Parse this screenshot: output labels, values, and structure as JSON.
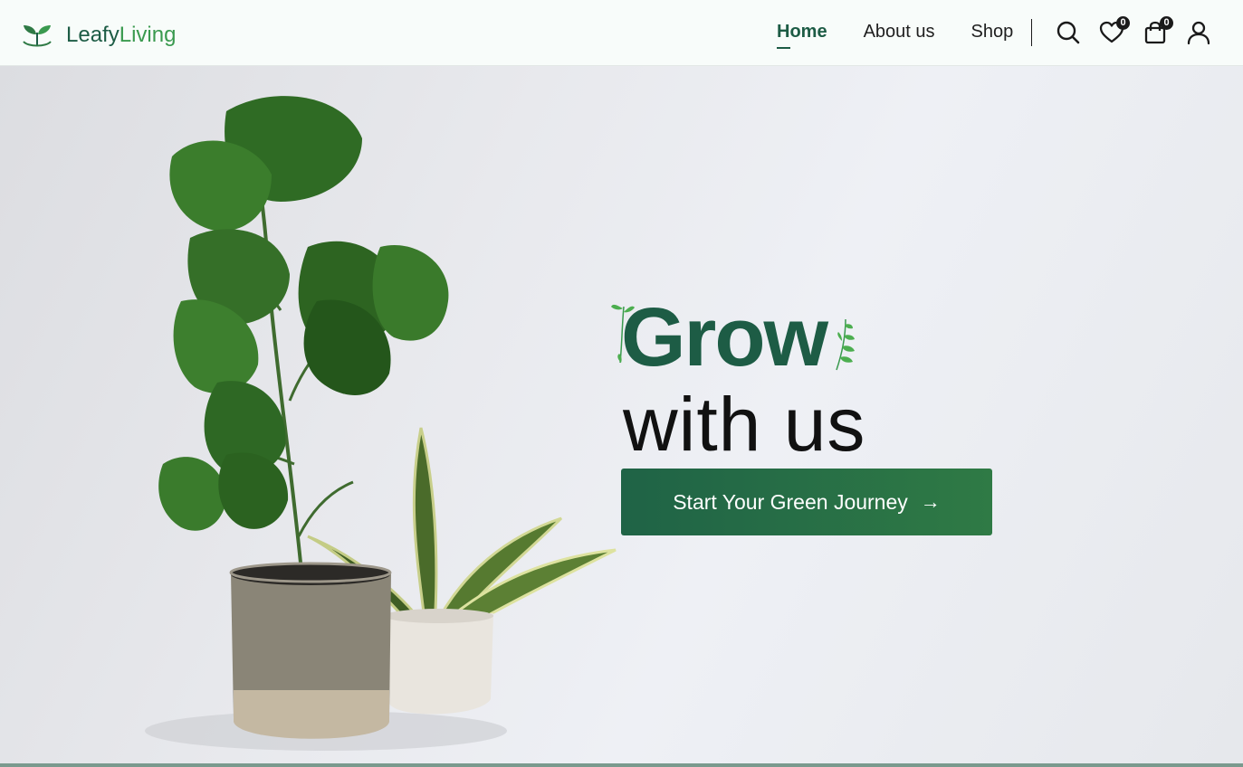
{
  "brand": {
    "name_part1": "Leafy",
    "name_part2": "Living"
  },
  "nav": {
    "items": [
      {
        "label": "Home",
        "active": true
      },
      {
        "label": "About us",
        "active": false
      },
      {
        "label": "Shop",
        "active": false
      }
    ]
  },
  "header_icons": {
    "search": "search-icon",
    "wishlist": {
      "icon": "heart-icon",
      "count": "0"
    },
    "cart": {
      "icon": "shopping-bag-icon",
      "count": "0"
    },
    "account": "user-icon"
  },
  "hero": {
    "headline_line1": "Grow",
    "headline_line2": "with us",
    "cta_label": "Start Your Green Journey",
    "cta_arrow": "→"
  },
  "colors": {
    "brand_dark_green": "#1d5c45",
    "brand_light_green": "#3a9a4f",
    "cta_gradient_start": "#1f6346",
    "cta_gradient_end": "#2f7a45"
  }
}
